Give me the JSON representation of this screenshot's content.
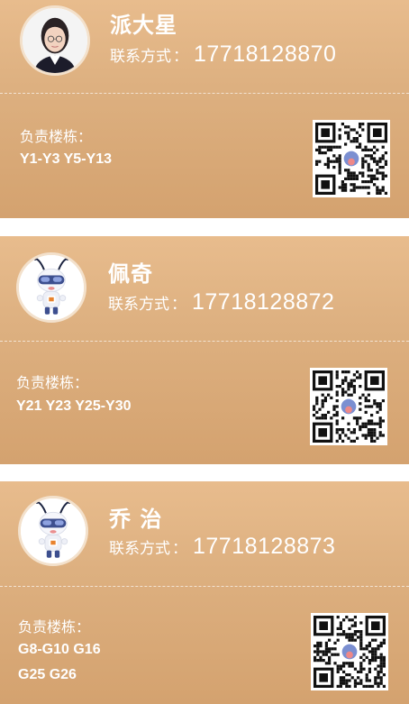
{
  "contacts": [
    {
      "name": "派大星",
      "contact_label": "联系方式",
      "colon": "：",
      "phone": "17718128870",
      "buildings_label": "负责楼栋：",
      "buildings_lines": [
        "Y1-Y3 Y5-Y13"
      ],
      "avatar_kind": "photo"
    },
    {
      "name": "佩奇",
      "contact_label": "联系方式",
      "colon": "：",
      "phone": "17718128872",
      "buildings_label": "负责楼栋：",
      "buildings_lines": [
        "Y21 Y23 Y25-Y30"
      ],
      "avatar_kind": "mascot"
    },
    {
      "name": "乔 治",
      "contact_label": "联系方式",
      "colon": "：",
      "phone": "17718128873",
      "buildings_label": "负责楼栋：",
      "buildings_lines": [
        "G8-G10 G16",
        "G25 G26"
      ],
      "avatar_kind": "mascot"
    }
  ],
  "colors": {
    "card_top": "#e8bc8d",
    "card_bottom": "#d4a26f",
    "text": "#ffffff"
  }
}
